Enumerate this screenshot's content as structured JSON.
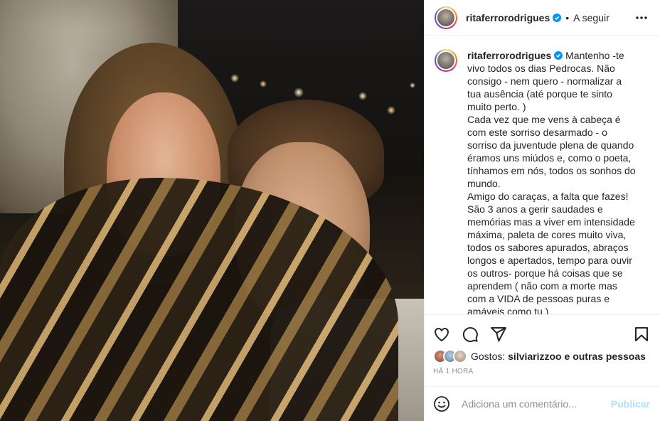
{
  "post": {
    "username": "ritaferrorodrigues",
    "follow_label": "A seguir",
    "dot": "•"
  },
  "caption": {
    "username": "ritaferrorodrigues",
    "text": "Mantenho -te vivo todos os dias Pedrocas. Não consigo - nem quero - normalizar a tua ausência (até porque te sinto muito perto. )\nCada vez que me vens à cabeça é com este sorriso desarmado - o sorriso da juventude plena de quando éramos uns miúdos e, como o poeta, tínhamos em nós, todos os sonhos do mundo.\nAmigo do caraças, a falta que fazes!\nSão 3 anos a gerir saudades e memórias mas a viver em intensidade máxima, paleta de cores muito viva, todos os sabores apurados, abraços longos e apertados, tempo para ouvir os outros- porque há coisas que se aprendem ( não com a morte mas com a VIDA de pessoas puras e amáveis como tu )"
  },
  "likes": {
    "prefix": "Gostos:",
    "user": "silviarizzoo",
    "connector": "e",
    "others": "outras pessoas"
  },
  "time": "HÁ 1 HORA",
  "comment": {
    "placeholder": "Adiciona um comentário...",
    "publish": "Publicar"
  },
  "icons": [
    "verified-badge-icon",
    "more-options-icon",
    "heart-icon",
    "comment-icon",
    "share-icon",
    "save-icon",
    "emoji-icon"
  ],
  "colors": {
    "verified": "#0095f6",
    "publish_disabled": "#b2dffc",
    "secondary_text": "#8e8e8e"
  }
}
